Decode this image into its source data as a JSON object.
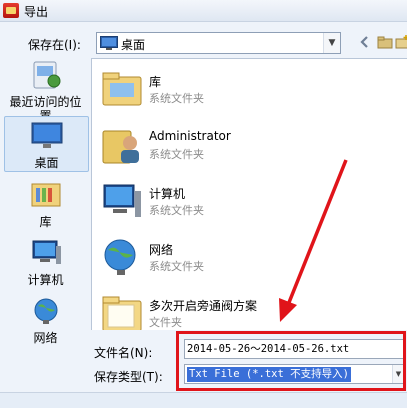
{
  "window": {
    "title": "导出"
  },
  "save_in": {
    "label": "保存在(I):",
    "value": "桌面"
  },
  "places": [
    {
      "label": "最近访问的位置",
      "icon": "recent-places-icon"
    },
    {
      "label": "桌面",
      "icon": "desktop-icon",
      "selected": true
    },
    {
      "label": "库",
      "icon": "libraries-icon"
    },
    {
      "label": "计算机",
      "icon": "computer-icon"
    },
    {
      "label": "网络",
      "icon": "network-icon"
    }
  ],
  "files": [
    {
      "name": "库",
      "type": "系统文件夹",
      "icon": "libraries-folder-icon"
    },
    {
      "name": "Administrator",
      "type": "系统文件夹",
      "icon": "user-folder-icon"
    },
    {
      "name": "计算机",
      "type": "系统文件夹",
      "icon": "computer-icon"
    },
    {
      "name": "网络",
      "type": "系统文件夹",
      "icon": "network-icon"
    },
    {
      "name": "多次开启旁通阀方案",
      "type": "文件夹",
      "icon": "folder-icon"
    }
  ],
  "filename": {
    "label": "文件名(N):",
    "value": "2014-05-26～2014-05-26.txt"
  },
  "filetype": {
    "label": "保存类型(T):",
    "value": "Txt File (*.txt 不支持导入)"
  },
  "toolbar": {
    "back_icon": "back-arrow-icon",
    "up_icon": "up-folder-icon",
    "new_folder_icon": "new-folder-icon",
    "views_icon": "views-menu-icon"
  },
  "colors": {
    "highlight": "#e0141a",
    "selection": "#3a6fd8"
  }
}
